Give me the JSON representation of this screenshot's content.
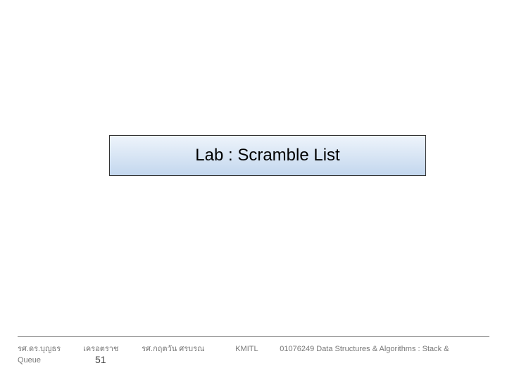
{
  "title": "Lab : Scramble List",
  "footer": {
    "author1": "รศ.ดร.บุญธร",
    "author2": "เครอตราช",
    "author3": "รศ.กฤตวัน   ศรบรณ",
    "institution": "KMITL",
    "course": "01076249 Data Structures & Algorithms : Stack &",
    "line2": "Queue",
    "page": "51"
  }
}
